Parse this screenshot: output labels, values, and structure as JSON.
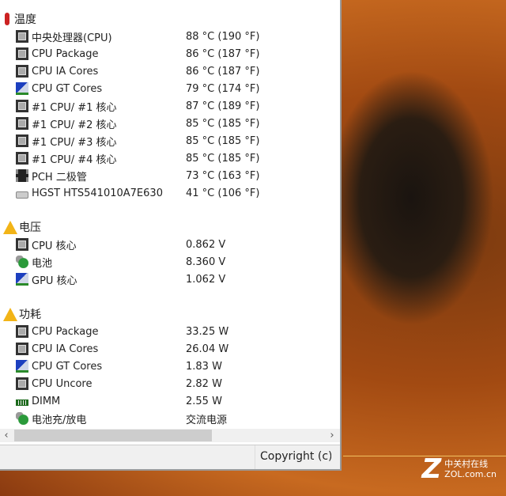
{
  "groups": [
    {
      "title": "温度",
      "icon": "thermometer",
      "items": [
        {
          "label": "中央处理器(CPU)",
          "value": "88 °C  (190 °F)",
          "icon": "cpu-chip"
        },
        {
          "label": "CPU Package",
          "value": "86 °C  (187 °F)",
          "icon": "cpu-chip"
        },
        {
          "label": "CPU IA Cores",
          "value": "86 °C  (187 °F)",
          "icon": "cpu-chip"
        },
        {
          "label": "CPU GT Cores",
          "value": "79 °C  (174 °F)",
          "icon": "gpu"
        },
        {
          "label": "#1 CPU/ #1 核心",
          "value": "87 °C  (189 °F)",
          "icon": "cpu-chip"
        },
        {
          "label": "#1 CPU/ #2 核心",
          "value": "85 °C  (185 °F)",
          "icon": "cpu-chip"
        },
        {
          "label": "#1 CPU/ #3 核心",
          "value": "85 °C  (185 °F)",
          "icon": "cpu-chip"
        },
        {
          "label": "#1 CPU/ #4 核心",
          "value": "85 °C  (185 °F)",
          "icon": "cpu-chip"
        },
        {
          "label": "PCH 二极管",
          "value": "73 °C  (163 °F)",
          "icon": "pch-chip"
        },
        {
          "label": "HGST HTS541010A7E630",
          "value": "41 °C  (106 °F)",
          "icon": "hdd"
        }
      ]
    },
    {
      "title": "电压",
      "icon": "warning",
      "items": [
        {
          "label": "CPU 核心",
          "value": "0.862 V",
          "icon": "cpu-chip"
        },
        {
          "label": "电池",
          "value": "8.360 V",
          "icon": "battery"
        },
        {
          "label": "GPU 核心",
          "value": "1.062 V",
          "icon": "gpu"
        }
      ]
    },
    {
      "title": "功耗",
      "icon": "warning",
      "items": [
        {
          "label": "CPU Package",
          "value": "33.25 W",
          "icon": "cpu-chip"
        },
        {
          "label": "CPU IA Cores",
          "value": "26.04 W",
          "icon": "cpu-chip"
        },
        {
          "label": "CPU GT Cores",
          "value": "1.83 W",
          "icon": "gpu"
        },
        {
          "label": "CPU Uncore",
          "value": "2.82 W",
          "icon": "cpu-chip"
        },
        {
          "label": "DIMM",
          "value": "2.55 W",
          "icon": "dimm"
        },
        {
          "label": "电池充/放电",
          "value": "交流电源",
          "icon": "battery"
        }
      ]
    }
  ],
  "status": {
    "copyright": "Copyright (c)"
  },
  "scroll": {
    "horizontal_position": 0,
    "visible_fraction": 0.6
  },
  "watermark": {
    "logo": "Z",
    "name": "中关村在线",
    "url": "ZOL.com.cn"
  }
}
